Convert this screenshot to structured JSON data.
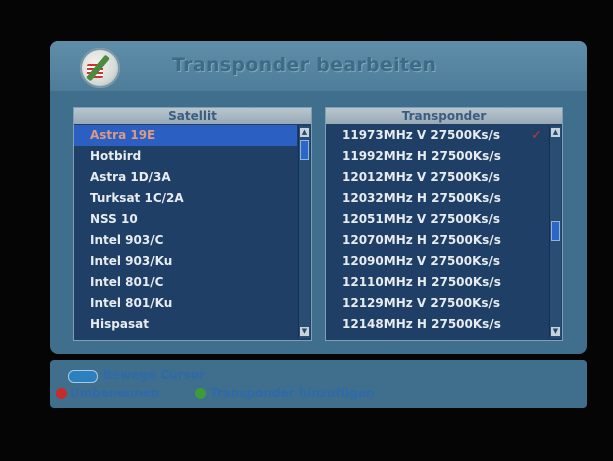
{
  "header": {
    "title": "Transponder bearbeiten"
  },
  "satellite_list": {
    "header": "Satellit",
    "items": [
      "Astra 19E",
      "Hotbird",
      "Astra 1D/3A",
      "Turksat 1C/2A",
      "NSS 10",
      "Intel 903/C",
      "Intel 903/Ku",
      "Intel 801/C",
      "Intel 801/Ku",
      "Hispasat"
    ],
    "selected_index": 0
  },
  "transponder_list": {
    "header": "Transponder",
    "items": [
      "11973MHz V 27500Ks/s",
      "11992MHz H 27500Ks/s",
      "12012MHz V 27500Ks/s",
      "12032MHz H 27500Ks/s",
      "12051MHz V 27500Ks/s",
      "12070MHz H 27500Ks/s",
      "12090MHz V 27500Ks/s",
      "12110MHz H 27500Ks/s",
      "12129MHz V 27500Ks/s",
      "12148MHz H 27500Ks/s"
    ],
    "checked_index": 0,
    "check_mark": "✓"
  },
  "footer": {
    "move_cursor": "Bewege Cursor",
    "rename": "Umbenennen",
    "add_transponder": "Transponder hinzufügen"
  },
  "colors": {
    "selected_row": "#2c5fc2",
    "red_key": "#c72b2b",
    "green_key": "#3f9a3a",
    "panel": "#3f6f8c"
  }
}
